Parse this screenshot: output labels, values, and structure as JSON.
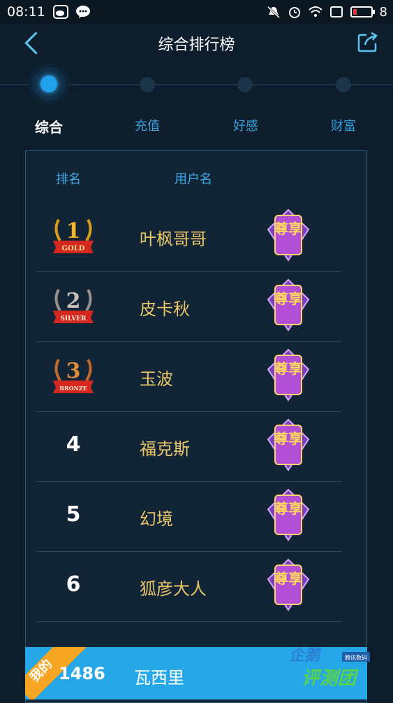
{
  "status_bar": {
    "time": "08:11",
    "battery": "8",
    "icons": [
      "weibo-icon",
      "wechat-icon",
      "mute-icon",
      "alarm-icon",
      "wifi-icon",
      "sim-icon",
      "battery-icon"
    ]
  },
  "header": {
    "title": "综合排行榜",
    "back_icon": "chevron-left-icon",
    "share_icon": "share-icon"
  },
  "tabs": [
    {
      "label": "综合",
      "active": true
    },
    {
      "label": "充值",
      "active": false
    },
    {
      "label": "好感",
      "active": false
    },
    {
      "label": "财富",
      "active": false
    }
  ],
  "table": {
    "col_rank": "排名",
    "col_user": "用户名",
    "rows": [
      {
        "rank": "1",
        "medal": "GOLD",
        "name": "叶枫哥哥",
        "badge": "尊享"
      },
      {
        "rank": "2",
        "medal": "SILVER",
        "name": "皮卡秋",
        "badge": "尊享"
      },
      {
        "rank": "3",
        "medal": "BRONZE",
        "name": "玉波",
        "badge": "尊享"
      },
      {
        "rank": "4",
        "medal": "",
        "name": "福克斯",
        "badge": "尊享"
      },
      {
        "rank": "5",
        "medal": "",
        "name": "幻境",
        "badge": "尊享"
      },
      {
        "rank": "6",
        "medal": "",
        "name": "狐彦大人",
        "badge": "尊享"
      }
    ]
  },
  "my_rank": {
    "tag": "我的",
    "rank": "1486",
    "name": "瓦西里"
  },
  "watermark": {
    "line1": "企鹅",
    "line2": "评测团",
    "tag": "腾讯数码"
  },
  "colors": {
    "background": "#0d1d2b",
    "accent": "#26a8e8",
    "name_gold": "#e9c56a",
    "tab_blue": "#37a3e3",
    "my_tag": "#f6a623"
  }
}
